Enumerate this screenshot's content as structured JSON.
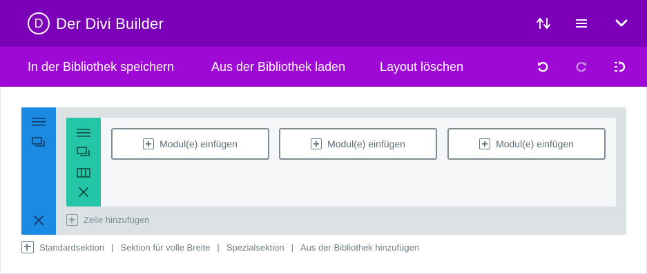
{
  "header": {
    "logo_letter": "D",
    "title": "Der Divi Builder",
    "icons": [
      "sort-arrows-icon",
      "hamburger-menu-icon",
      "chevron-down-icon"
    ]
  },
  "toolbar": {
    "save_to_library": "In der Bibliothek speichern",
    "load_from_library": "Aus der Bibliothek laden",
    "clear_layout": "Layout löschen",
    "icons": [
      "undo-icon",
      "redo-icon",
      "history-icon"
    ]
  },
  "section": {
    "icons": [
      "section-menu-icon",
      "section-duplicate-icon",
      "section-delete-icon"
    ],
    "row": {
      "icons": [
        "row-menu-icon",
        "row-duplicate-icon",
        "row-columns-icon",
        "row-delete-icon"
      ],
      "modules": [
        {
          "label": "Modul(e) einfügen"
        },
        {
          "label": "Modul(e) einfügen"
        },
        {
          "label": "Modul(e) einfügen"
        }
      ]
    },
    "add_row_label": "Zeile hinzufügen"
  },
  "add_section": {
    "separator": "|",
    "links": [
      {
        "label": "Standardsektion"
      },
      {
        "label": "Sektion für volle Breite"
      },
      {
        "label": "Spezialsektion"
      },
      {
        "label": "Aus der Bibliothek hinzufügen"
      }
    ]
  },
  "colors": {
    "header_bg": "#7c00b8",
    "toolbar_bg": "#9f09d6",
    "section_handle": "#1a8ae2",
    "row_handle": "#25c6a8",
    "section_bg": "#dce1e3"
  }
}
